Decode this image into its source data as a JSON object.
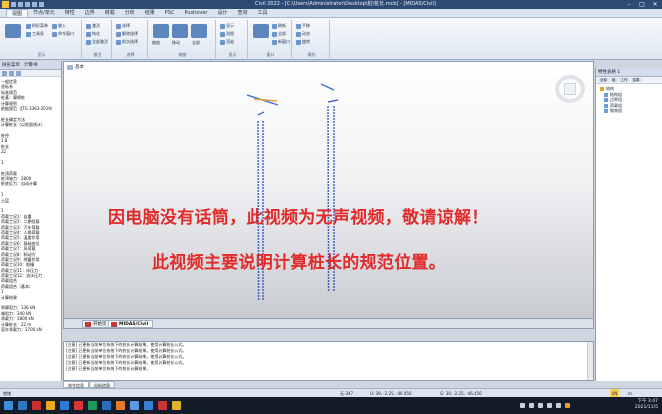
{
  "titlebar": {
    "title": "Civil 2022 - [C:\\Users\\Administrator\\Desktop\\桩\\桩长.mcb] - [MIDAS/Civil]"
  },
  "tabs": [
    "视图",
    "节点/单元",
    "特性",
    "边界",
    "荷载",
    "分析",
    "结果",
    "PSC",
    "Pushover",
    "设计",
    "查询",
    "工具"
  ],
  "ribbon": {
    "groups": [
      {
        "label": "显示",
        "buttons": [
          "树形菜单",
          "工具条",
          "输入",
          "命令窗口"
        ]
      },
      {
        "label": "激活",
        "buttons": [
          "激活",
          "钝化",
          "全部激活",
          "反选激活"
        ]
      },
      {
        "label": "选择",
        "buttons": [
          "选择",
          "解除选择",
          "前次选择"
        ]
      },
      {
        "label": "缩放",
        "buttons": [
          "缩放",
          "移动",
          "全部",
          "上次",
          "正视图"
        ]
      },
      {
        "label": "显示",
        "buttons": [
          "显示",
          "消隐",
          "渲染",
          "正交"
        ]
      },
      {
        "label": "窗口",
        "buttons": [
          "窗口",
          "刷新",
          "全部",
          "新窗口"
        ]
      },
      {
        "label": "操作",
        "buttons": [
          "平移",
          "动态",
          "旋转"
        ]
      }
    ]
  },
  "left_panel": {
    "header": [
      "树形菜单",
      "计算书"
    ],
    "lines": [
      "一般信息",
      "坐标系",
      "标准规范",
      "桩基：摩擦桩",
      "计算规则",
      "依据规范（JTG 3363-2019）",
      "",
      "桩长确定方法",
      "计算桩长（以地面线计）",
      "",
      "桩径",
      "1.8",
      "桩长",
      "22",
      "",
      "1",
      "",
      "桩顶荷载",
      "桩顶轴力：2800",
      "桩底反力：自动计算",
      "",
      "1",
      "土层",
      "",
      "1",
      "荷载工况1：自重",
      "荷载工况2：二期恒载",
      "荷载工况3：汽车荷载",
      "荷载工况4：人群荷载",
      "荷载工况5：温度作用",
      "荷载工况6：基础变位",
      "荷载工况7：风荷载",
      "荷载工况8：制动力",
      "荷载工况9：地震作用",
      "荷载工况10：船撞",
      "荷载工况11：冰压力",
      "荷载工况12：流水压力",
      "荷载组合",
      "荷载组合（基本）",
      "1",
      "计算结果",
      "",
      "侧摩阻力：136 kN",
      "端阻力：340 kN",
      "承载力：1800 kN",
      "计算桩长：22 m",
      "容许承载力：3700 kN"
    ],
    "bottom_tab": "树形"
  },
  "viewport": {
    "tab_label": "基本",
    "overlay_line1": "因电脑没有话筒，此视频为无声视频，敬请谅解！",
    "overlay_line2": "此视频主要说明计算桩长的规范位置。",
    "bottom_tabs": [
      "开始页",
      "MIDAS/Civil"
    ]
  },
  "messages": {
    "lines": [
      "[注意] 已更新当前单位系统下的桩长计算结果。使用计算桩长公式。",
      "[注意] 已更新当前单位系统下的桩长计算结果。使用计算桩长公式。",
      "[注意] 已更新当前单位系统下的桩长计算结果。使用计算桩长公式。",
      "[注意] 已更新当前单位系统下的桩长计算结果。使用计算桩长公式。",
      "[注意] 已更新当前单位系统下的桩长计算结果。"
    ],
    "tabs": [
      "命令信息",
      "分析信息"
    ]
  },
  "right_panel": {
    "header": "特性表格 1",
    "tabs": [
      "全部",
      "组",
      "工作",
      "结果"
    ],
    "tree": [
      {
        "label": "结构",
        "level": 0
      },
      {
        "label": "结构组",
        "level": 1
      },
      {
        "label": "边界组",
        "level": 1
      },
      {
        "label": "荷载组",
        "level": 1
      },
      {
        "label": "钢束组",
        "level": 1
      }
    ]
  },
  "statusbar": {
    "left": "就绪",
    "node": "无-347",
    "coord": "U: 39, -2.25, -46.456",
    "gcoord": "G: 39, -2.25, -46.456",
    "unit": "kN",
    "unit2": "m"
  },
  "taskbar": {
    "time": "下午 3:47",
    "date": "2021/11/5"
  }
}
